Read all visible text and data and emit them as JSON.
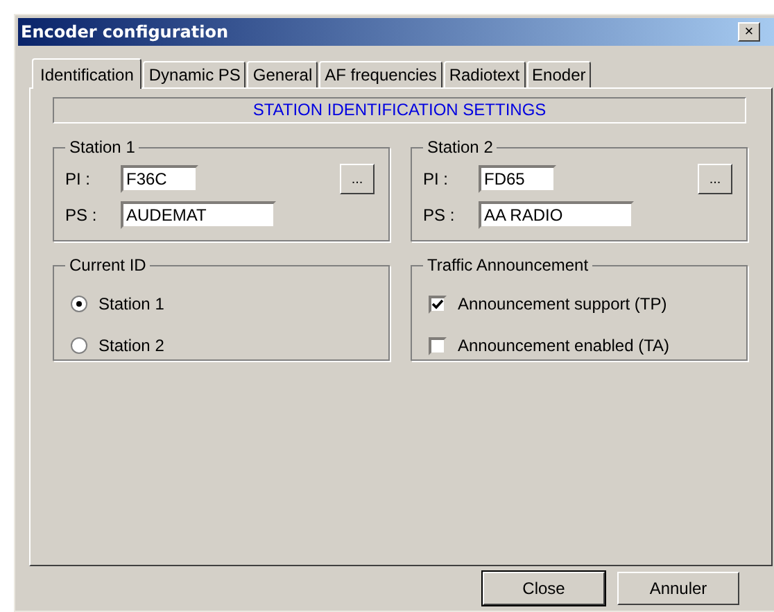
{
  "window": {
    "title": "Encoder configuration",
    "close": "×"
  },
  "tabs": [
    {
      "label": "Identification",
      "selected": true
    },
    {
      "label": "Dynamic PS",
      "selected": false
    },
    {
      "label": "General",
      "selected": false
    },
    {
      "label": "AF frequencies",
      "selected": false
    },
    {
      "label": "Radiotext",
      "selected": false
    },
    {
      "label": "Enoder",
      "selected": false
    }
  ],
  "header": "STATION IDENTIFICATION SETTINGS",
  "stations": [
    {
      "title": "Station 1",
      "pi_label": "PI :",
      "pi": "F36C",
      "ps_label": "PS :",
      "ps": "AUDEMAT",
      "browse": "..."
    },
    {
      "title": "Station 2",
      "pi_label": "PI :",
      "pi": "FD65",
      "ps_label": "PS :",
      "ps": "AA RADIO",
      "browse": "..."
    }
  ],
  "current_id": {
    "title": "Current ID",
    "options": [
      {
        "label": "Station 1",
        "selected": true
      },
      {
        "label": "Station 2",
        "selected": false
      }
    ]
  },
  "traffic": {
    "title": "Traffic Announcement",
    "options": [
      {
        "label": "Announcement support (TP)",
        "checked": true
      },
      {
        "label": "Announcement enabled (TA)",
        "checked": false
      }
    ]
  },
  "buttons": [
    {
      "label": "Close",
      "default": true
    },
    {
      "label": "Annuler",
      "default": false
    }
  ]
}
